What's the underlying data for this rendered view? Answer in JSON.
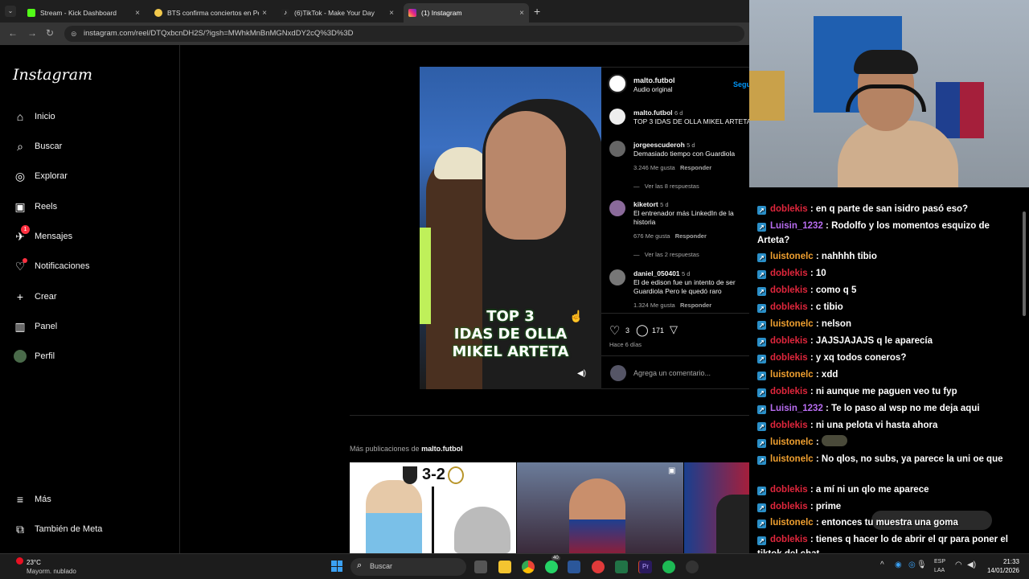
{
  "browser": {
    "tabs": [
      {
        "title": "Stream - Kick Dashboard",
        "color": "#53fc18"
      },
      {
        "title": "BTS confirma conciertos en Per",
        "color": "#f2c94c"
      },
      {
        "title": "(6)TikTok - Make Your Day",
        "color": "#ffffff"
      },
      {
        "title": "(1) Instagram",
        "color": "#e1306c"
      }
    ],
    "url": "instagram.com/reel/DTQxbcnDH2S/?igsh=MWhkMnBnMGNxdDY2cQ%3D%3D"
  },
  "sidebar": {
    "logo": "Instagram",
    "items": [
      {
        "label": "Inicio",
        "icon": "home-icon"
      },
      {
        "label": "Buscar",
        "icon": "search-icon"
      },
      {
        "label": "Explorar",
        "icon": "compass-icon"
      },
      {
        "label": "Reels",
        "icon": "reels-icon"
      },
      {
        "label": "Mensajes",
        "icon": "messenger-icon",
        "badge": "1"
      },
      {
        "label": "Notificaciones",
        "icon": "heart-icon"
      },
      {
        "label": "Crear",
        "icon": "plus-icon"
      },
      {
        "label": "Panel",
        "icon": "dashboard-icon"
      },
      {
        "label": "Perfil",
        "icon": "avatar-icon"
      }
    ],
    "bottom": [
      {
        "label": "Más",
        "icon": "menu-icon"
      },
      {
        "label": "También de Meta",
        "icon": "meta-icon"
      }
    ]
  },
  "reel": {
    "overlay_text": [
      "TOP 3",
      "IDAS DE OLLA",
      "MIKEL ARTETA"
    ]
  },
  "post": {
    "author": "malto.futbol",
    "audio": "Audio original",
    "follow": "Segu",
    "caption": {
      "user": "malto.futbol",
      "time": "6 d",
      "text": "TOP 3 IDAS DE OLLA MIKEL ARTETA"
    },
    "comments": [
      {
        "user": "jorgeescuderoh",
        "time": "5 d",
        "text": "Demasiado tiempo con Guardiola",
        "likes": "3.246 Me gusta",
        "reply": "Responder",
        "view": "Ver las 8 respuestas"
      },
      {
        "user": "kiketort",
        "time": "5 d",
        "text": "El entrenador más LinkedIn de la historia",
        "likes": "676 Me gusta",
        "reply": "Responder",
        "view": "Ver las 2 respuestas"
      },
      {
        "user": "daniel_050401",
        "time": "5 d",
        "text": "El de edison fue un intento de ser Guardiola Pero le quedó raro",
        "likes": "1.324 Me gusta",
        "reply": "Responder"
      }
    ],
    "like_count": "3",
    "comment_count": "171",
    "age": "Hace 6 días",
    "add_comment_placeholder": "Agrega un comentario..."
  },
  "more_posts": {
    "label": "Más publicaciones de",
    "user": "malto.futbol",
    "thumb1_score": "3-2"
  },
  "chat": [
    {
      "user": "doblekis",
      "text": "en q parte de san isidro pasó eso?",
      "color": "#e0263c"
    },
    {
      "user": "Luisin_1232",
      "text": "Rodolfo y los momentos esquizo de Arteta?",
      "color": "#b76cf0"
    },
    {
      "user": "luistonelc",
      "text": "nahhhh tibio",
      "color": "#f0a030"
    },
    {
      "user": "doblekis",
      "text": "10",
      "color": "#e0263c"
    },
    {
      "user": "doblekis",
      "text": "como q 5",
      "color": "#e0263c"
    },
    {
      "user": "doblekis",
      "text": "c tibio",
      "color": "#e0263c"
    },
    {
      "user": "luistonelc",
      "text": "nelson",
      "color": "#f0a030"
    },
    {
      "user": "doblekis",
      "text": "JAJSJAJAJS q le aparecía",
      "color": "#e0263c"
    },
    {
      "user": "doblekis",
      "text": "y xq todos coneros?",
      "color": "#e0263c"
    },
    {
      "user": "luistonelc",
      "text": "xdd",
      "color": "#f0a030"
    },
    {
      "user": "doblekis",
      "text": "ni aunque me paguen veo tu fyp",
      "color": "#e0263c"
    },
    {
      "user": "Luisin_1232",
      "text": "Te lo paso al wsp no me deja aqui",
      "color": "#b76cf0"
    },
    {
      "user": "doblekis",
      "text": "ni una pelota vi hasta ahora",
      "color": "#e0263c"
    },
    {
      "user": "luistonelc",
      "text": "",
      "color": "#f0a030"
    },
    {
      "user": "luistonelc",
      "text": "No qlos, no subs, ya parece la uni oe que",
      "color": "#f0a030"
    },
    {
      "user": "doblekis",
      "text": "a mí ni un qlo me aparece",
      "color": "#e0263c"
    },
    {
      "user": "doblekis",
      "text": "prime",
      "color": "#e0263c"
    },
    {
      "user": "luistonelc",
      "text": "entonces tu muestra una goma",
      "color": "#f0a030"
    },
    {
      "user": "doblekis",
      "text": "tienes q hacer lo de abrir el qr para poner el tiktok del chat",
      "color": "#e0263c"
    }
  ],
  "taskbar": {
    "weather_temp": "23°C",
    "weather_desc": "Mayorm. nublado",
    "search": "Buscar",
    "lang": "ESP",
    "lang2": "LAA",
    "time": "21:33",
    "date": "14/01/2026",
    "whatsapp_badge": "40"
  }
}
